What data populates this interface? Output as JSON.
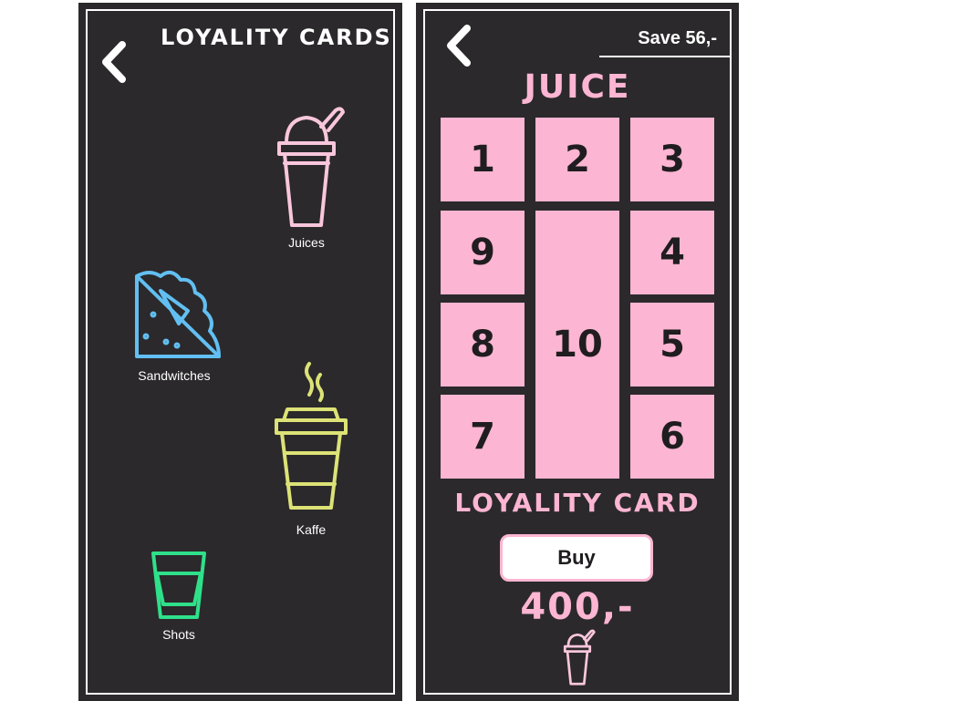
{
  "left": {
    "title": "LOYALITY CARDS",
    "categories": [
      {
        "label": "Juices",
        "icon": "juice-cup-icon",
        "color": "#f9c6dc"
      },
      {
        "label": "Sandwitches",
        "icon": "sandwich-icon",
        "color": "#62bff2"
      },
      {
        "label": "Kaffe",
        "icon": "coffee-cup-icon",
        "color": "#dce276"
      },
      {
        "label": "Shots",
        "icon": "shot-glass-icon",
        "color": "#2fe08a"
      }
    ]
  },
  "right": {
    "save_label": "Save 56,-",
    "title": "JUICE",
    "stamps": [
      "1",
      "2",
      "3",
      "4",
      "5",
      "6",
      "7",
      "8",
      "9",
      "10"
    ],
    "card_label": "LOYALITY CARD",
    "buy_label": "Buy",
    "price": "400,-",
    "icon": "juice-cup-icon"
  },
  "colors": {
    "background": "#2b292b",
    "accent_pink": "#fcb5d2",
    "white": "#ffffff"
  }
}
